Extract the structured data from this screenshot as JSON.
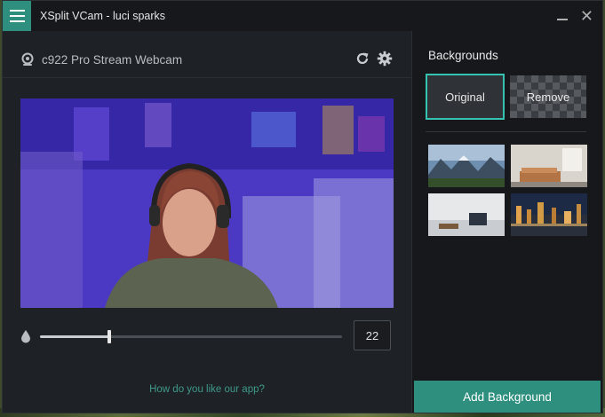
{
  "window": {
    "title": "XSplit VCam - luci sparks"
  },
  "camera": {
    "name": "c922 Pro Stream Webcam"
  },
  "blur": {
    "value": "22",
    "level_fraction": 0.23
  },
  "feedback_link": "How do you like our app?",
  "backgrounds": {
    "heading": "Backgrounds",
    "original_label": "Original",
    "remove_label": "Remove",
    "add_button": "Add Background"
  },
  "colors": {
    "accent": "#2f8f7f",
    "selected_border": "#35c2b0",
    "window_bg": "#1e2125",
    "panel_bg": "#16181b",
    "link": "#3e9a8a"
  },
  "icons": {
    "menu": "hamburger-icon",
    "minimize": "minimize-icon",
    "close": "close-icon",
    "webcam": "webcam-icon",
    "refresh": "refresh-icon",
    "settings": "gear-icon",
    "blur": "droplet-icon"
  }
}
